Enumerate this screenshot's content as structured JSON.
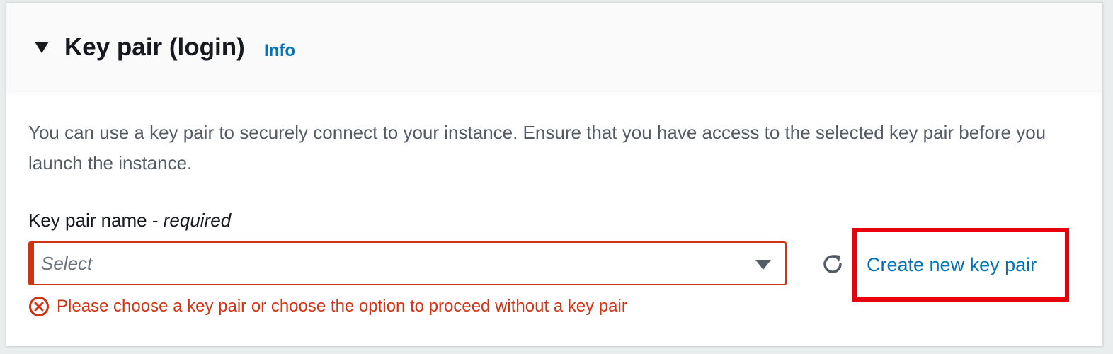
{
  "section": {
    "title": "Key pair (login)",
    "info_label": "Info",
    "description": "You can use a key pair to securely connect to your instance. Ensure that you have access to the selected key pair before you launch the instance."
  },
  "field": {
    "label": "Key pair name -",
    "required_label": "required",
    "placeholder": "Select",
    "error": "Please choose a key pair or choose the option to proceed without a key pair"
  },
  "actions": {
    "create_label": "Create new key pair",
    "refresh_icon": "refresh-icon"
  },
  "colors": {
    "link": "#0073bb",
    "error": "#d13212",
    "highlight": "#e8000b"
  }
}
